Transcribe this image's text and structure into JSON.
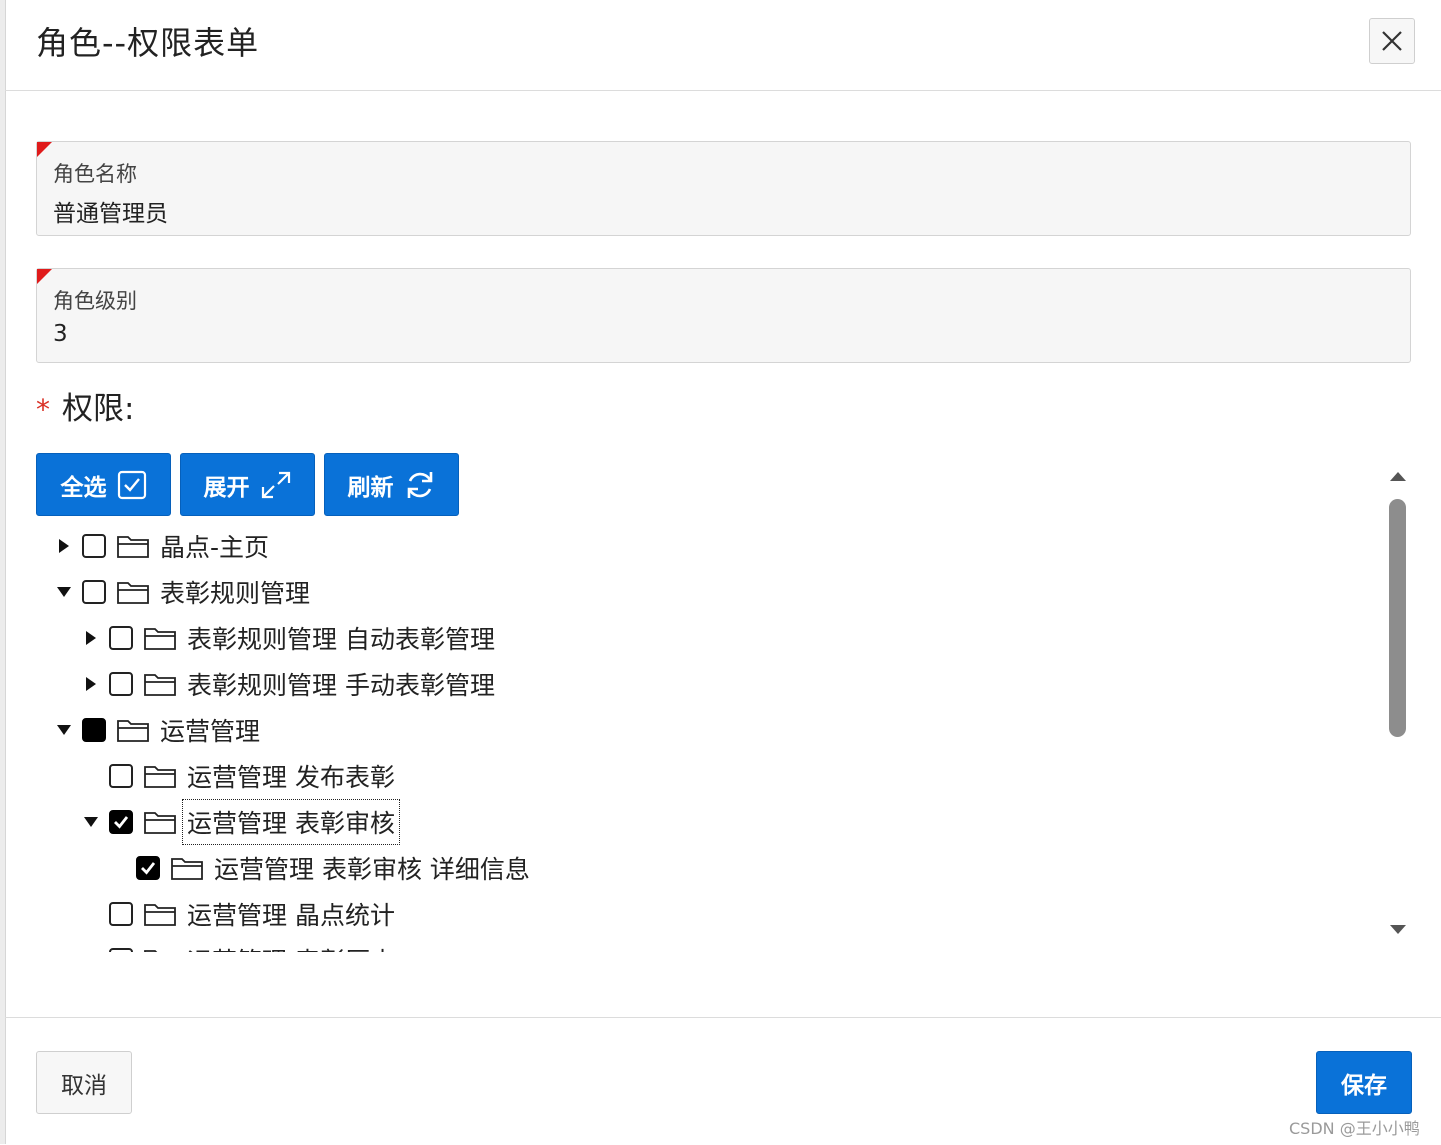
{
  "dialog": {
    "title": "角色--权限表单"
  },
  "form": {
    "role_name": {
      "label": "角色名称",
      "value": "普通管理员"
    },
    "role_level": {
      "label": "角色级别",
      "value": "3"
    },
    "permissions_label": "权限:",
    "required_mark": "*"
  },
  "toolbar": {
    "select_all_label": "全选",
    "expand_label": "展开",
    "refresh_label": "刷新"
  },
  "tree": {
    "nodes": [
      {
        "label": "晶点-主页",
        "depth": 0,
        "toggle": "collapsed",
        "state": "unchecked"
      },
      {
        "label": "表彰规则管理",
        "depth": 0,
        "toggle": "expanded",
        "state": "unchecked"
      },
      {
        "label": "表彰规则管理 自动表彰管理",
        "depth": 1,
        "toggle": "collapsed",
        "state": "unchecked"
      },
      {
        "label": "表彰规则管理 手动表彰管理",
        "depth": 1,
        "toggle": "collapsed",
        "state": "unchecked"
      },
      {
        "label": "运营管理",
        "depth": 0,
        "toggle": "expanded",
        "state": "partial"
      },
      {
        "label": "运营管理 发布表彰",
        "depth": 1,
        "toggle": "none",
        "state": "unchecked"
      },
      {
        "label": "运营管理 表彰审核",
        "depth": 1,
        "toggle": "expanded",
        "state": "checked",
        "focused": true
      },
      {
        "label": "运营管理 表彰审核 详细信息",
        "depth": 2,
        "toggle": "none",
        "state": "checked"
      },
      {
        "label": "运营管理 晶点统计",
        "depth": 1,
        "toggle": "none",
        "state": "unchecked"
      },
      {
        "label": "运营管理 表彰历史",
        "depth": 1,
        "toggle": "collapsed",
        "state": "unchecked"
      }
    ]
  },
  "footer": {
    "cancel_label": "取消",
    "save_label": "保存"
  },
  "watermark": "CSDN @王小小鸭",
  "colors": {
    "primary": "#0a72d8",
    "required": "#e01b1b",
    "field_bg": "#f6f6f6"
  }
}
